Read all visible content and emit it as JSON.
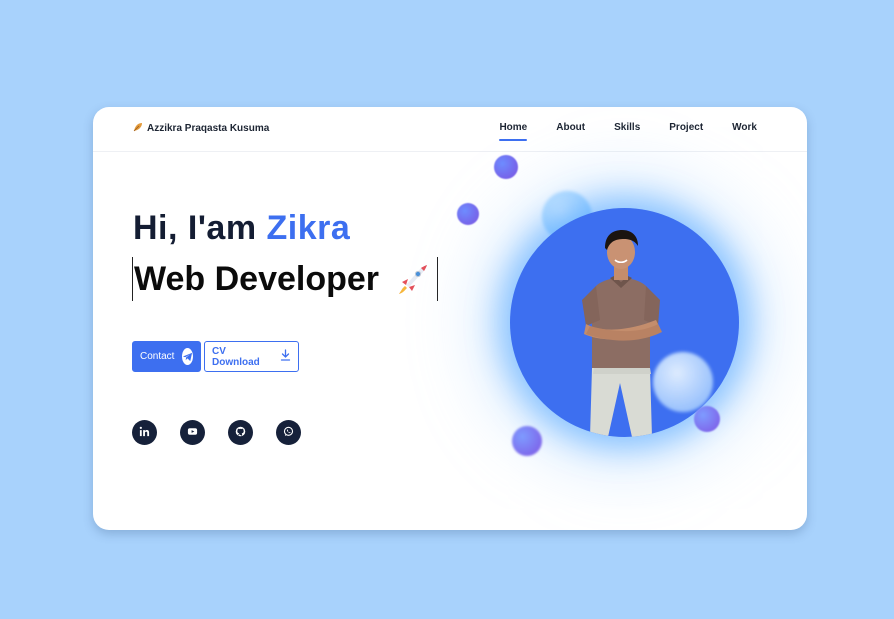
{
  "brand": {
    "name": "Azzikra Praqasta Kusuma",
    "icon": "leaf-icon"
  },
  "nav": {
    "items": [
      {
        "label": "Home",
        "active": true
      },
      {
        "label": "About",
        "active": false
      },
      {
        "label": "Skills",
        "active": false
      },
      {
        "label": "Project",
        "active": false
      },
      {
        "label": "Work",
        "active": false
      }
    ]
  },
  "hero": {
    "greeting": "Hi, I'am",
    "name": "Zikra",
    "role": "Web Developer",
    "role_icon": "rocket-icon"
  },
  "buttons": {
    "contact_label": "Contact",
    "contact_icon": "telegram-icon",
    "cv_label": "CV Download",
    "cv_icon": "download-icon"
  },
  "socials": [
    {
      "icon": "linkedin-icon"
    },
    {
      "icon": "youtube-icon"
    },
    {
      "icon": "github-icon"
    },
    {
      "icon": "whatsapp-icon"
    }
  ],
  "colors": {
    "accent": "#3d6ff0",
    "background": "#a8d2fc",
    "text": "#141d33"
  }
}
